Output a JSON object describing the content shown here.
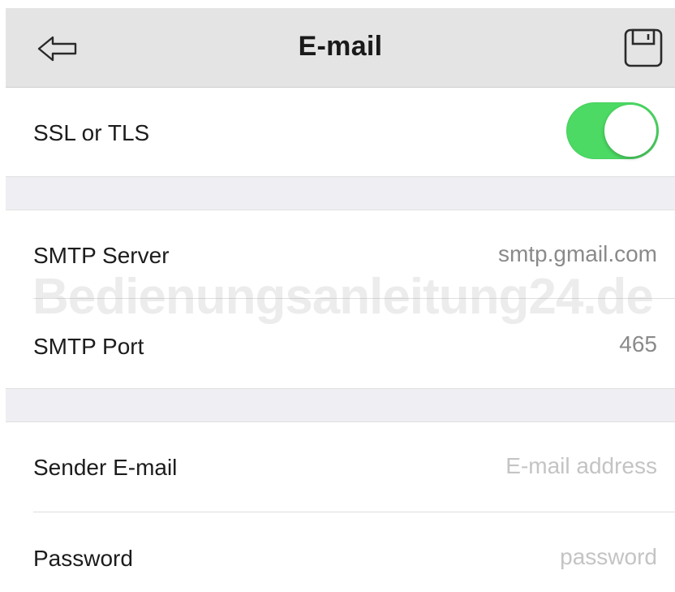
{
  "navbar": {
    "title": "E-mail",
    "back_icon": "back-arrow-icon",
    "save_icon": "save-icon"
  },
  "ssl": {
    "label": "SSL or TLS",
    "enabled": true,
    "toggle_color": "#4cd964"
  },
  "smtp": {
    "server_label": "SMTP Server",
    "server_value": "smtp.gmail.com",
    "port_label": "SMTP Port",
    "port_value": "465"
  },
  "credentials": {
    "sender_label": "Sender E-mail",
    "sender_value": "",
    "sender_placeholder": "E-mail address",
    "password_label": "Password",
    "password_value": "",
    "password_placeholder": "password"
  },
  "watermark": "Bedienungsanleitung24.de"
}
